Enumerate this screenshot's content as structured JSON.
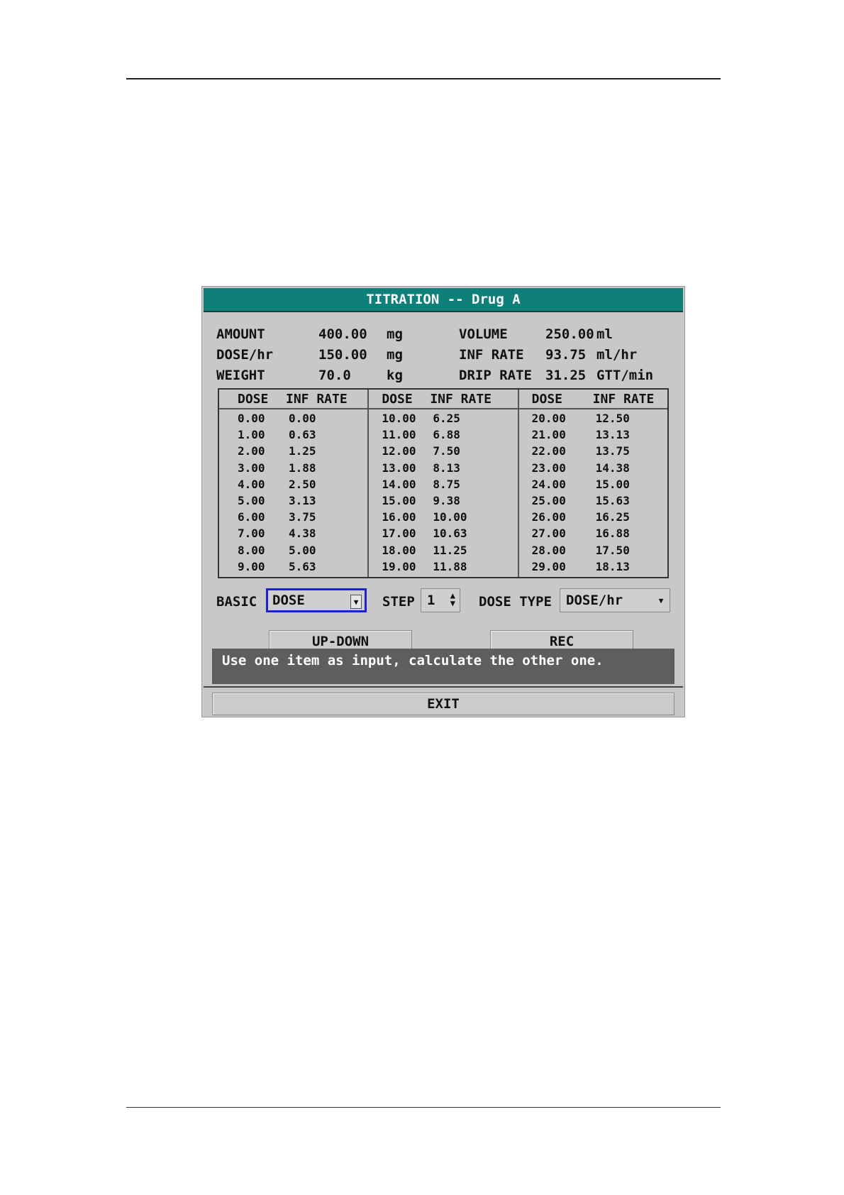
{
  "dialog": {
    "title": "TITRATION -- Drug A",
    "info": [
      {
        "label": "AMOUNT",
        "value": "400.00",
        "unit": "mg",
        "label2": "VOLUME",
        "value2": "250.00",
        "unit2": "ml"
      },
      {
        "label": "DOSE/hr",
        "value": "150.00",
        "unit": "mg",
        "label2": "INF RATE",
        "value2": "93.75",
        "unit2": "ml/hr"
      },
      {
        "label": "WEIGHT",
        "value": "70.0",
        "unit": "kg",
        "label2": "DRIP RATE",
        "value2": "31.25",
        "unit2": "GTT/min"
      }
    ],
    "table": {
      "header_dose": "DOSE",
      "header_rate": "INF RATE",
      "columns": [
        {
          "rows": [
            [
              "0.00",
              "0.00"
            ],
            [
              "1.00",
              "0.63"
            ],
            [
              "2.00",
              "1.25"
            ],
            [
              "3.00",
              "1.88"
            ],
            [
              "4.00",
              "2.50"
            ],
            [
              "5.00",
              "3.13"
            ],
            [
              "6.00",
              "3.75"
            ],
            [
              "7.00",
              "4.38"
            ],
            [
              "8.00",
              "5.00"
            ],
            [
              "9.00",
              "5.63"
            ]
          ]
        },
        {
          "rows": [
            [
              "10.00",
              "6.25"
            ],
            [
              "11.00",
              "6.88"
            ],
            [
              "12.00",
              "7.50"
            ],
            [
              "13.00",
              "8.13"
            ],
            [
              "14.00",
              "8.75"
            ],
            [
              "15.00",
              "9.38"
            ],
            [
              "16.00",
              "10.00"
            ],
            [
              "17.00",
              "10.63"
            ],
            [
              "18.00",
              "11.25"
            ],
            [
              "19.00",
              "11.88"
            ]
          ]
        },
        {
          "rows": [
            [
              "20.00",
              "12.50"
            ],
            [
              "21.00",
              "13.13"
            ],
            [
              "22.00",
              "13.75"
            ],
            [
              "23.00",
              "14.38"
            ],
            [
              "24.00",
              "15.00"
            ],
            [
              "25.00",
              "15.63"
            ],
            [
              "26.00",
              "16.25"
            ],
            [
              "27.00",
              "16.88"
            ],
            [
              "28.00",
              "17.50"
            ],
            [
              "29.00",
              "18.13"
            ]
          ]
        }
      ]
    },
    "controls": {
      "basic_label": "BASIC",
      "basic_value": "DOSE",
      "step_label": "STEP",
      "step_value": "1",
      "dose_type_label": "DOSE TYPE",
      "dose_type_value": "DOSE/hr"
    },
    "buttons": {
      "updown": "UP-DOWN",
      "rec": "REC",
      "exit": "EXIT"
    },
    "hint": "Use one item as input, calculate the other one.",
    "icons": {
      "dropdown": "chevron-down-icon",
      "spinner": "up-down-arrow-icon"
    },
    "colors": {
      "title_bg": "#0f7f7a",
      "focus": "#1a24c6",
      "dialog_bg": "#c8c8c8",
      "hint_bg": "#5e5e5e"
    }
  }
}
